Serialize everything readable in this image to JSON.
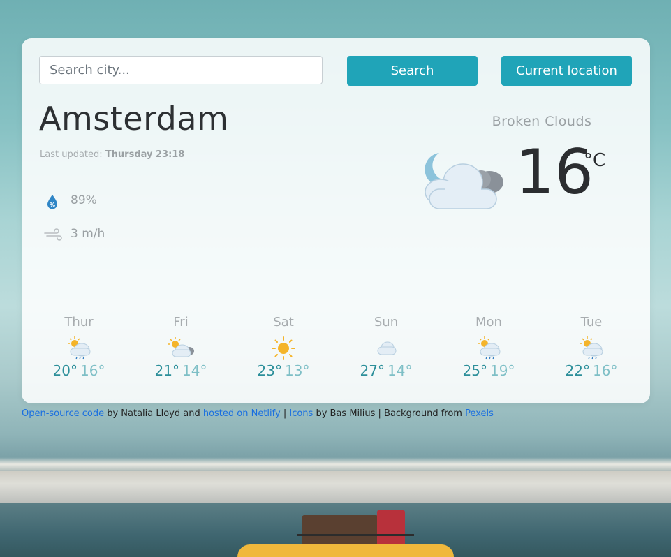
{
  "search": {
    "placeholder": "Search city...",
    "value": ""
  },
  "buttons": {
    "search": "Search",
    "location": "Current location"
  },
  "weather": {
    "city": "Amsterdam",
    "updated_label": "Last updated:",
    "updated_value": "Thursday 23:18",
    "humidity": "89%",
    "wind": "3 m/h",
    "description": "Broken Clouds",
    "temperature": "16",
    "unit": "°C",
    "icon": "partly-cloudy-night-icon"
  },
  "forecast": [
    {
      "day": "Thur",
      "max": "20°",
      "min": "16°",
      "icon": "sun-cloud-rain-icon"
    },
    {
      "day": "Fri",
      "max": "21°",
      "min": "14°",
      "icon": "sun-clouds-icon"
    },
    {
      "day": "Sat",
      "max": "23°",
      "min": "13°",
      "icon": "sun-icon"
    },
    {
      "day": "Sun",
      "max": "27°",
      "min": "14°",
      "icon": "cloud-icon"
    },
    {
      "day": "Mon",
      "max": "25°",
      "min": "19°",
      "icon": "sun-cloud-rain-icon"
    },
    {
      "day": "Tue",
      "max": "22°",
      "min": "16°",
      "icon": "sun-cloud-rain-icon"
    }
  ],
  "footer": {
    "code_link": "Open-source code",
    "by_text": " by Natalia Lloyd and ",
    "hosted_link": "hosted on Netlify",
    "sep1": " | ",
    "icons_link": "Icons",
    "icons_by": " by Bas Milius | Background from ",
    "pexels_link": "Pexels"
  },
  "colors": {
    "accent": "#20a4b8",
    "max_temp": "#2c8f9a",
    "min_temp": "#7ebfc6",
    "link": "#1a6fe0"
  }
}
